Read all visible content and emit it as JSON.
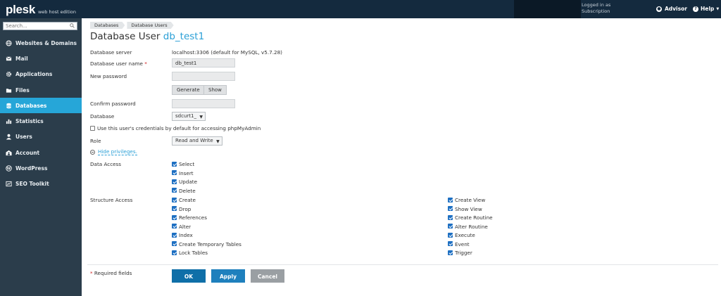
{
  "header": {
    "logo": "plesk",
    "edition": "web host edition",
    "logged_in_line1": "Logged in as",
    "logged_in_line2": "Subscription",
    "advisor": "Advisor",
    "help": "Help"
  },
  "sidebar": {
    "search_placeholder": "Search...",
    "items": [
      {
        "label": "Websites & Domains",
        "icon": "globe-icon"
      },
      {
        "label": "Mail",
        "icon": "mail-icon"
      },
      {
        "label": "Applications",
        "icon": "gear-icon"
      },
      {
        "label": "Files",
        "icon": "folder-icon"
      },
      {
        "label": "Databases",
        "icon": "database-icon",
        "active": true
      },
      {
        "label": "Statistics",
        "icon": "chart-icon"
      },
      {
        "label": "Users",
        "icon": "user-icon"
      },
      {
        "label": "Account",
        "icon": "account-icon"
      },
      {
        "label": "WordPress",
        "icon": "wordpress-icon"
      },
      {
        "label": "SEO Toolkit",
        "icon": "seo-icon"
      }
    ]
  },
  "breadcrumbs": [
    "Databases",
    "Database Users"
  ],
  "title": {
    "prefix": "Database User",
    "user": "db_test1"
  },
  "form": {
    "db_server_label": "Database server",
    "db_server_value": "localhost:3306 (default for MySQL, v5.7.28)",
    "username_label": "Database user name",
    "required_mark": "*",
    "username_value": "db_test1",
    "new_password_label": "New password",
    "generate_label": "Generate",
    "show_label": "Show",
    "confirm_password_label": "Confirm password",
    "database_label": "Database",
    "database_value": "sdcurt1_",
    "phpmyadmin_label": "Use this user's credentials by default for accessing phpMyAdmin",
    "role_label": "Role",
    "role_value": "Read and Write",
    "hide_privileges": "Hide privileges.",
    "data_access_label": "Data Access",
    "data_access": [
      "Select",
      "Insert",
      "Update",
      "Delete"
    ],
    "structure_access_label": "Structure Access",
    "structure_left": [
      "Create",
      "Drop",
      "References",
      "Alter",
      "Index",
      "Create Temporary Tables",
      "Lock Tables"
    ],
    "structure_right": [
      "Create View",
      "Show View",
      "Create Routine",
      "Alter Routine",
      "Execute",
      "Event",
      "Trigger"
    ],
    "required_fields": "* Required fields",
    "ok_label": "OK",
    "apply_label": "Apply",
    "cancel_label": "Cancel"
  },
  "colors": {
    "topbar": "#142a3e",
    "sidebar": "#2b3d4b",
    "active_nav": "#26a6d8",
    "ok_button": "#0f6fa8",
    "apply_button": "#1e80bd",
    "cancel_button": "#9a9fa3",
    "link": "#2a9fd6"
  }
}
